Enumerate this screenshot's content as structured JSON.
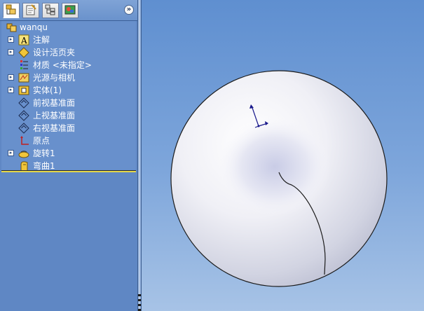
{
  "tabs": [
    {
      "name": "feature-manager",
      "icon": "feature-tree-icon",
      "active": true
    },
    {
      "name": "property-manager",
      "icon": "property-manager-icon",
      "active": false
    },
    {
      "name": "configuration-manager",
      "icon": "configuration-manager-icon",
      "active": false
    },
    {
      "name": "display-manager",
      "icon": "display-manager-icon",
      "active": false
    }
  ],
  "collapse_glyph": "»",
  "tree": {
    "root": {
      "label": "wanqu",
      "icon": "part-icon"
    },
    "items": [
      {
        "label": "注解",
        "icon": "annotations-icon",
        "expandable": true
      },
      {
        "label": "设计活页夹",
        "icon": "design-binder-icon",
        "expandable": true
      },
      {
        "label": "材质 <未指定>",
        "icon": "material-icon",
        "expandable": false
      },
      {
        "label": "光源与相机",
        "icon": "lights-cameras-icon",
        "expandable": true
      },
      {
        "label": "实体(1)",
        "icon": "solid-bodies-icon",
        "expandable": true
      },
      {
        "label": "前视基准面",
        "icon": "plane-icon",
        "expandable": false
      },
      {
        "label": "上视基准面",
        "icon": "plane-icon",
        "expandable": false
      },
      {
        "label": "右视基准面",
        "icon": "plane-icon",
        "expandable": false
      },
      {
        "label": "原点",
        "icon": "origin-icon",
        "expandable": false
      },
      {
        "label": "旋转1",
        "icon": "revolve-icon",
        "expandable": true
      },
      {
        "label": "弯曲1",
        "icon": "flex-icon",
        "expandable": false
      }
    ]
  },
  "colors": {
    "panel_bg": "#6890cc",
    "viewport_top": "#5f8fd0",
    "viewport_bottom": "#a7c3e6",
    "model_fill": "#f3f3f8",
    "triad_color": "#1a1a8c"
  }
}
